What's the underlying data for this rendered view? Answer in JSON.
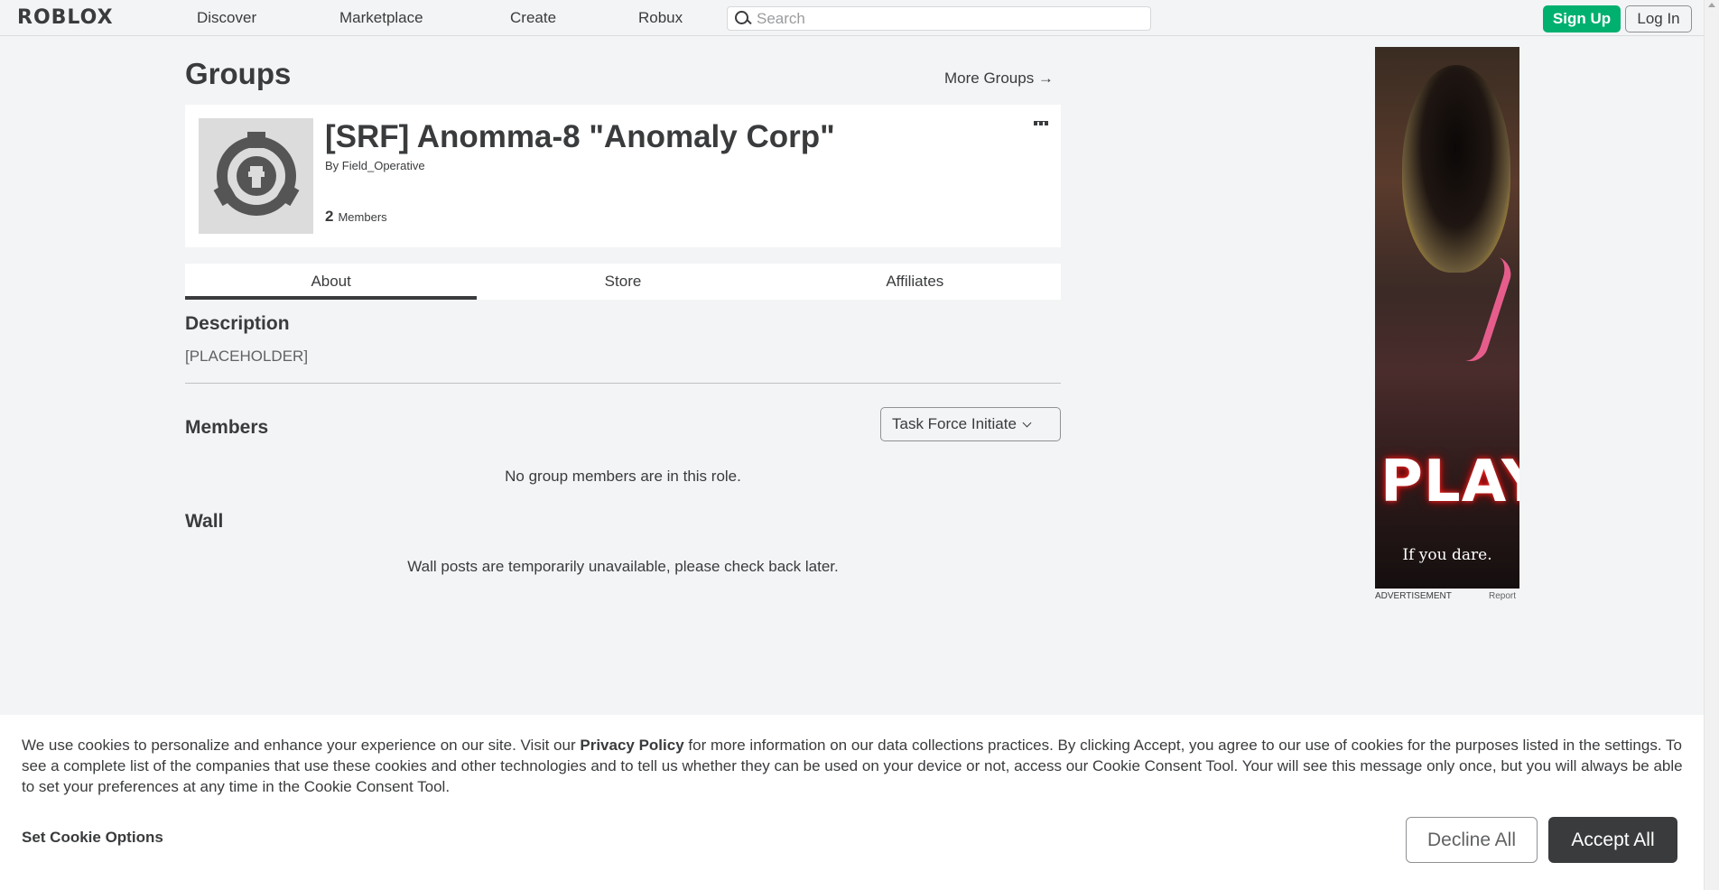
{
  "header": {
    "logo": "ROBLOX",
    "nav": [
      "Discover",
      "Marketplace",
      "Create",
      "Robux"
    ],
    "search_placeholder": "Search",
    "signup": "Sign Up",
    "login": "Log In"
  },
  "page": {
    "title": "Groups",
    "more_groups": "More Groups →"
  },
  "group": {
    "name": "[SRF] Anomma-8 \"Anomaly Corp\"",
    "by_prefix": "By",
    "owner": "Field_Operative",
    "member_count": "2",
    "members_label": "Members"
  },
  "tabs": [
    "About",
    "Store",
    "Affiliates"
  ],
  "about": {
    "description_heading": "Description",
    "description_text": "[PLACEHOLDER]",
    "members_heading": "Members",
    "role_selected": "Task Force Initiate",
    "no_members_msg": "No group members are in this role.",
    "wall_heading": "Wall",
    "wall_msg": "Wall posts are temporarily unavailable, please check back later."
  },
  "ad": {
    "headline": "PLAY",
    "tagline": "If you dare.",
    "label": "ADVERTISEMENT",
    "report": "Report"
  },
  "cookie_banner": {
    "text_before": "We use cookies to personalize and enhance your experience on our site. Visit our ",
    "privacy_link": "Privacy Policy",
    "text_after": " for more information on our data collections practices. By clicking Accept, you agree to our use of cookies for the purposes listed in the settings. To see a complete list of the companies that use these cookies and other technologies and to tell us whether they can be used on your device or not, access our Cookie Consent Tool. Your will see this message only once, but you will always be able to set your preferences at any time in the Cookie Consent Tool.",
    "set_options": "Set Cookie Options",
    "decline": "Decline All",
    "accept": "Accept All"
  },
  "colors": {
    "signup_green": "#00b06f",
    "text_dark": "#393b3d",
    "page_bg": "#f2f4f5",
    "accept_bg": "#393b3d"
  }
}
